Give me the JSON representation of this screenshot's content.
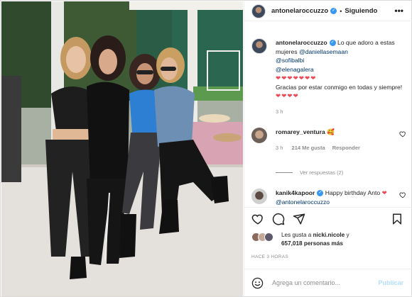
{
  "post": {
    "username": "antonelaroccuzzo",
    "follow_label": "Siguiendo",
    "more_label": "•••"
  },
  "caption": {
    "username": "antonelaroccuzzo",
    "text": "Lo que adoro a estas mujeres",
    "mentions": [
      "@daniellasemaan",
      "@sofibalbi",
      "@elenagalera"
    ],
    "hearts": "❤❤❤❤❤❤❤",
    "text2": "Gracias por estar conmigo en todas y siempre!",
    "hearts2": "❤❤❤❤",
    "time": "3 h"
  },
  "comments": [
    {
      "username": "romarey_ventura",
      "text": "🥰",
      "time": "3 h",
      "likes": "214 Me gusta",
      "reply_label": "Responder"
    },
    {
      "username": "kanik4kapoor",
      "text": "Happy birthday Anto",
      "mention": "@antonelaroccuzzo"
    }
  ],
  "view_replies": "Ver respuestas (2)",
  "likes": {
    "prefix": "Les gusta a",
    "user": "nicki.nicole",
    "conj": "y",
    "count": "657,018 personas más"
  },
  "ago": "HACE 3 HORAS",
  "add_comment": {
    "placeholder": "Agrega un comentario...",
    "publish_label": "Publicar"
  },
  "colors": {
    "accent": "#3897f0",
    "heart": "#ed4956",
    "link": "#00376b",
    "publish_disabled": "#b2dffc"
  }
}
